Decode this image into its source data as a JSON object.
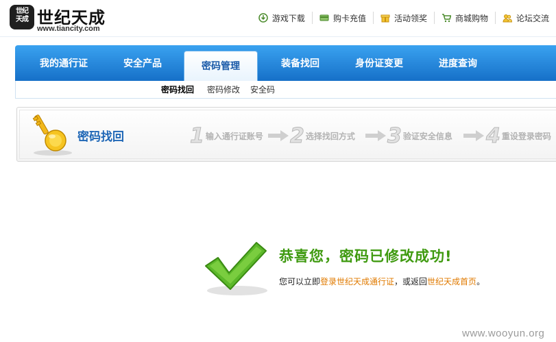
{
  "logo": {
    "badge_text": "世纪天成",
    "name": "世纪天成",
    "url": "www.tiancity.com"
  },
  "toplinks": [
    {
      "label": "游戏下载",
      "icon": "download-icon"
    },
    {
      "label": "购卡充值",
      "icon": "card-icon"
    },
    {
      "label": "活动领奖",
      "icon": "gift-icon"
    },
    {
      "label": "商城购物",
      "icon": "cart-icon"
    },
    {
      "label": "论坛交流",
      "icon": "users-icon"
    }
  ],
  "nav": {
    "items": [
      {
        "label": "我的通行证"
      },
      {
        "label": "安全产品"
      },
      {
        "label": "密码管理",
        "active": true
      },
      {
        "label": "装备找回"
      },
      {
        "label": "身份证变更"
      },
      {
        "label": "进度查询"
      }
    ]
  },
  "subnav": {
    "items": [
      {
        "label": "密码找回",
        "active": true
      },
      {
        "label": "密码修改"
      },
      {
        "label": "安全码"
      }
    ]
  },
  "steps": {
    "title": "密码找回",
    "items": [
      {
        "num": "1",
        "label": "输入通行证账号"
      },
      {
        "num": "2",
        "label": "选择找回方式"
      },
      {
        "num": "3",
        "label": "验证安全信息"
      },
      {
        "num": "4",
        "label": "重设登录密码"
      }
    ]
  },
  "success": {
    "title": "恭喜您，密码已修改成功",
    "title_mark": "!",
    "prefix": "您可以立即",
    "link1": "登录世纪天成通行证",
    "middle": "，或返回",
    "link2": "世纪天成首页",
    "suffix": "。"
  },
  "watermark": "www.wooyun.org",
  "colors": {
    "nav_top": "#3aa2f0",
    "nav_bottom": "#1670c8",
    "success_green": "#3f9a10",
    "link_orange": "#e07a00",
    "step_title_blue": "#1f67b6"
  }
}
